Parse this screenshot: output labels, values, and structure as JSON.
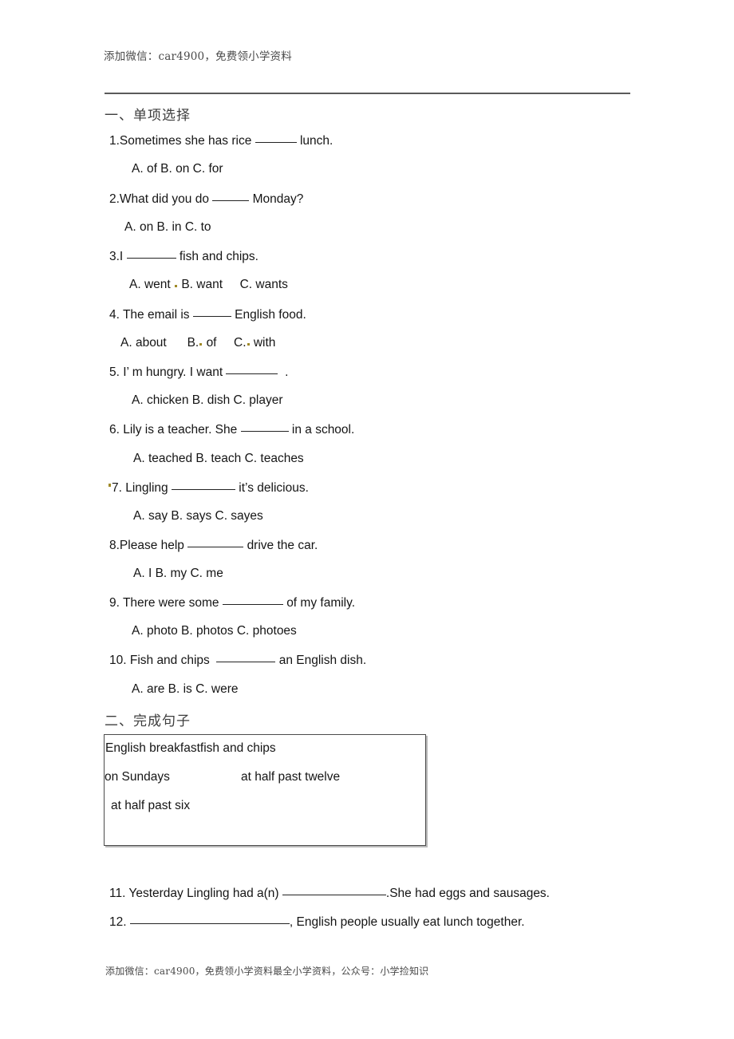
{
  "header": {
    "watermark": "添加微信：car4900，免费领小学资料"
  },
  "section_one": {
    "heading": "一、单项选择",
    "questions": [
      {
        "stem_before": "1.Sometimes she has rice",
        "stem_after": "lunch.",
        "blank_width": 52,
        "options": "A. of      B. on     C. for"
      },
      {
        "stem_before": "2.What did you do",
        "stem_after": "Monday?",
        "blank_width": 46,
        "options": "A. on     B. in      C. to"
      },
      {
        "stem_before": "3.I",
        "stem_after": "fish and chips.",
        "blank_width": 62,
        "options_a": "A. went",
        "options_b": "B. want",
        "options_c": "C. wants"
      },
      {
        "stem_before": "4. The email is",
        "stem_after": "English food.",
        "blank_width": 48,
        "options_a": "A. about",
        "options_b": "B.",
        "options_b2": "of",
        "options_c": "C.",
        "options_c2": "with"
      },
      {
        "stem_before": "5. I’ m hungry. I want",
        "stem_after": ".",
        "blank_width": 65,
        "options": "A. chicken      B. dish      C. player"
      },
      {
        "stem_before": "6. Lily is a teacher. She",
        "stem_after": "in a school.",
        "blank_width": 60,
        "options": "A. teached        B. teach        C. teaches"
      },
      {
        "stem_before": "7. Lingling",
        "stem_after": "it’s delicious.",
        "blank_width": 80,
        "options": "A. say          B. says       C. sayes"
      },
      {
        "stem_before": "8.Please help",
        "stem_after": "drive the car.",
        "blank_width": 70,
        "options": "A. I           B. my          C. me"
      },
      {
        "stem_before": "9. There were some",
        "stem_after": "of my family.",
        "blank_width": 76,
        "options": "A. photo         B. photos       C. photoes"
      },
      {
        "stem_before": "10. Fish and chips",
        "stem_after": "an English dish.",
        "blank_width": 74,
        "options": "A. are           B. is          C. were"
      }
    ]
  },
  "section_two": {
    "heading": "二、完成句子",
    "word_bank": {
      "line1": "English breakfastfish and chips",
      "line2_left": "on Sundays",
      "line2_right": "at half past twelve",
      "line3": "at half past six"
    },
    "fill_questions": [
      {
        "before": "11. Yesterday Lingling had a(n)",
        "blank_width": 130,
        "after": ".She had eggs and sausages."
      },
      {
        "before": "12.",
        "blank_width": 200,
        "after": ", English people usually eat lunch together."
      }
    ]
  },
  "footer": {
    "watermark": "添加微信：car4900，免费领小学资料最全小学资料，公众号：小学捡知识"
  },
  "colors": {
    "rule": "#5a5a5a",
    "text": "#151515",
    "heading": "#3d3d3d",
    "watermark": "#4a4a4a",
    "stray_mark": "#a08a28",
    "box_border": "#4b4b4b"
  }
}
